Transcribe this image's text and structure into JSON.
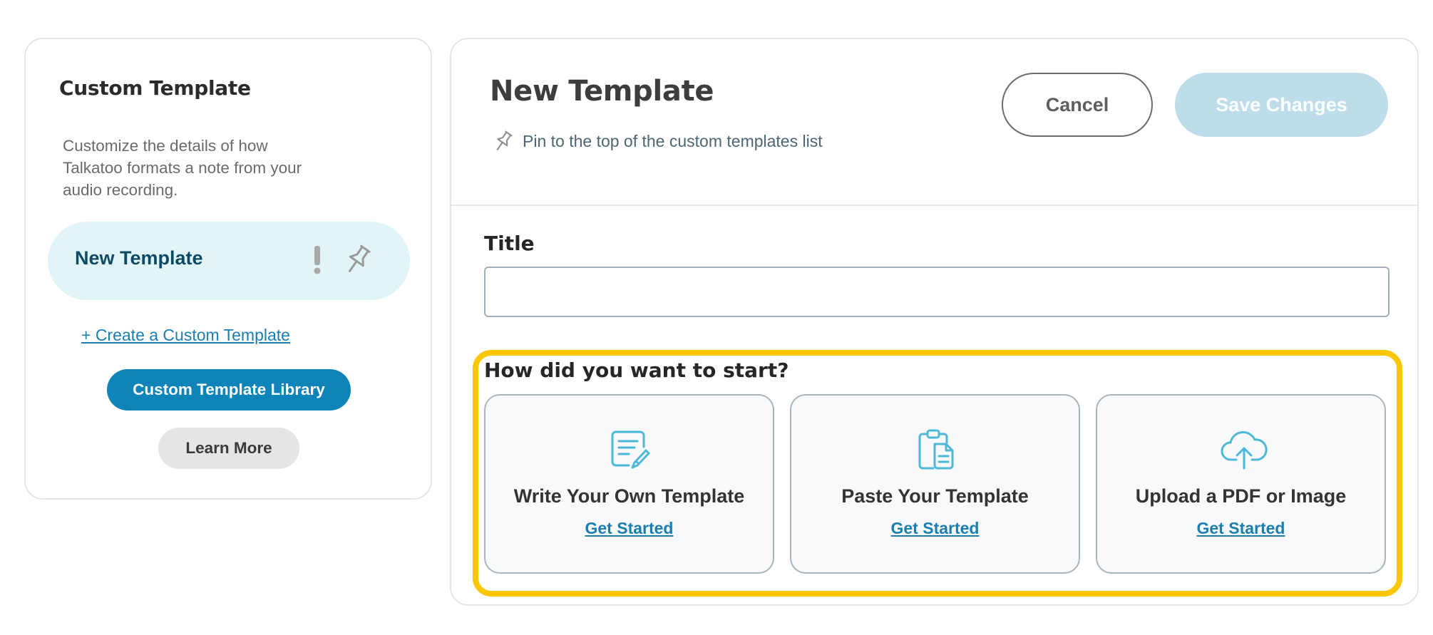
{
  "sidebar": {
    "title": "Custom Template",
    "description": "Customize the details of how Talkatoo formats a note from your audio recording.",
    "template_item": {
      "label": "New Template",
      "status_icon": "warning-icon",
      "pin_icon": "pin-icon"
    },
    "create_link": "+ Create a Custom Template",
    "library_button": "Custom Template Library",
    "learn_more_button": "Learn More"
  },
  "editor": {
    "title": "New Template",
    "pin_label": "Pin to the top of the custom templates list",
    "cancel_button": "Cancel",
    "save_button": "Save Changes",
    "save_enabled": false,
    "title_field": {
      "label": "Title",
      "value": "",
      "placeholder": ""
    },
    "start_section": {
      "heading": "How did you want to start?",
      "options": [
        {
          "title": "Write Your Own Template",
          "link": "Get Started",
          "icon": "document-pen-icon"
        },
        {
          "title": "Paste Your Template",
          "link": "Get Started",
          "icon": "clipboard-icon"
        },
        {
          "title": "Upload a PDF or Image",
          "link": "Get Started",
          "icon": "cloud-upload-icon"
        }
      ]
    }
  },
  "colors": {
    "primary": "#0e84b8",
    "link": "#1a7fb0",
    "highlight": "#fcc700",
    "active_item_bg": "#e1f4f8",
    "disabled_button_bg": "#bcdde9",
    "icon": "#4db8d8"
  }
}
